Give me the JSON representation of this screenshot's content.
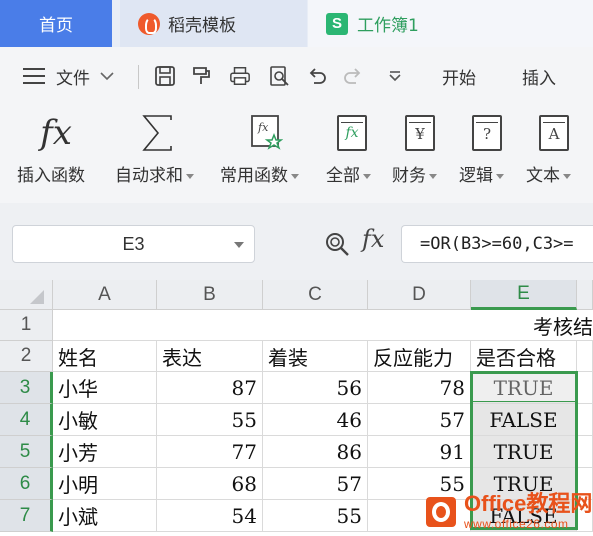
{
  "tabs": {
    "home": "首页",
    "daoke": "稻壳模板",
    "workbook": "工作簿1",
    "workbook_icon_letter": "S"
  },
  "quick_access": {
    "file_label": "文件",
    "start_tab": "开始",
    "insert_tab": "插入"
  },
  "function_ribbon": {
    "insert_function": "插入函数",
    "auto_sum": "自动求和",
    "common_functions": "常用函数",
    "all": "全部",
    "finance": "财务",
    "logic": "逻辑",
    "text": "文本",
    "finance_glyph": "¥",
    "logic_glyph": "?",
    "text_glyph": "A"
  },
  "formula_bar": {
    "name_box": "E3",
    "fx": "fx",
    "formula": "=OR(B3>=60,C3>="
  },
  "sheet": {
    "columns": [
      "A",
      "B",
      "C",
      "D",
      "E"
    ],
    "active_column": "E",
    "row_numbers": [
      "1",
      "2",
      "3",
      "4",
      "5",
      "6",
      "7"
    ],
    "title_partial": "考核结",
    "headers": [
      "姓名",
      "表达",
      "着装",
      "反应能力",
      "是否合格"
    ],
    "rows": [
      [
        "小华",
        "87",
        "56",
        "78",
        "TRUE"
      ],
      [
        "小敏",
        "55",
        "46",
        "57",
        "FALSE"
      ],
      [
        "小芳",
        "77",
        "86",
        "91",
        "TRUE"
      ],
      [
        "小明",
        "68",
        "57",
        "55",
        "TRUE"
      ],
      [
        "小斌",
        "54",
        "55",
        "",
        "FALSE"
      ]
    ]
  },
  "watermark": {
    "main": "Office教程网",
    "sub": "www.office26.com"
  },
  "colors": {
    "home_tab": "#4a7de8",
    "selection_green": "#3a9a4e",
    "watermark_orange": "#e8521b"
  }
}
